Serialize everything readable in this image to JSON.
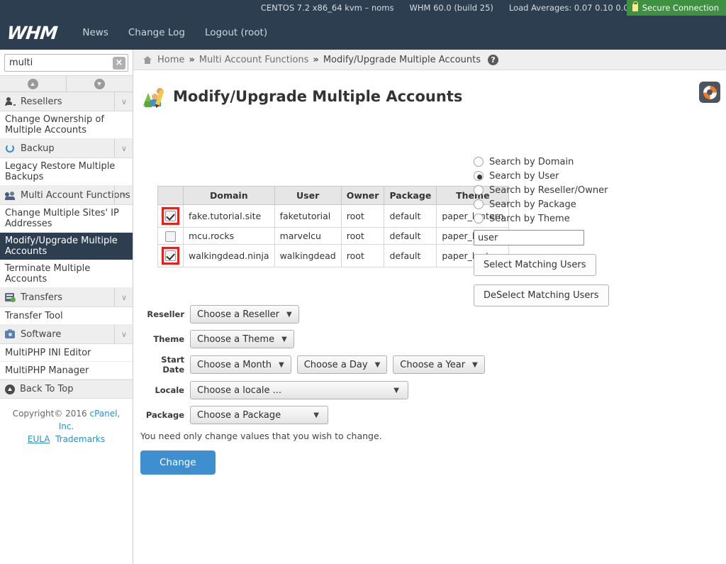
{
  "topbar": {
    "os": "CENTOS 7.2 x86_64 kvm – noms",
    "version": "WHM 60.0 (build 25)",
    "load": "Load Averages: 0.07 0.10 0.07",
    "secure_label": "Secure Connection",
    "lock_icon": "lock-icon",
    "secure_color": "#3d9140"
  },
  "nav": {
    "logo": "WHM",
    "links": [
      {
        "label": "News"
      },
      {
        "label": "Change Log"
      },
      {
        "label": "Logout (root)"
      }
    ]
  },
  "sidebar": {
    "search_value": "multi",
    "search_placeholder": "Search",
    "clear_icon": "close-icon",
    "scroll_up_icon": "chevron-up-icon",
    "scroll_down_icon": "chevron-down-icon",
    "items": [
      {
        "type": "category",
        "label": "Resellers",
        "icon": "resellers-icon",
        "chevron": "∨"
      },
      {
        "type": "leaf",
        "label": "Change Ownership of Multiple Accounts",
        "active": false
      },
      {
        "type": "category",
        "label": "Backup",
        "icon": "backup-icon",
        "chevron": "∨"
      },
      {
        "type": "leaf",
        "label": "Legacy Restore Multiple Backups",
        "active": false
      },
      {
        "type": "category",
        "label": "Multi Account Functions",
        "icon": "multi-account-icon",
        "chevron": "∨"
      },
      {
        "type": "leaf",
        "label": "Change Multiple Sites' IP Addresses",
        "active": false
      },
      {
        "type": "leaf",
        "label": "Modify/Upgrade Multiple Accounts",
        "active": true
      },
      {
        "type": "leaf",
        "label": "Terminate Multiple Accounts",
        "active": false
      },
      {
        "type": "category",
        "label": "Transfers",
        "icon": "transfers-icon",
        "chevron": "∨"
      },
      {
        "type": "leaf",
        "label": "Transfer Tool",
        "active": false
      },
      {
        "type": "category",
        "label": "Software",
        "icon": "software-icon",
        "chevron": "∨"
      },
      {
        "type": "leaf",
        "label": "MultiPHP INI Editor",
        "active": false
      },
      {
        "type": "leaf",
        "label": "MultiPHP Manager",
        "active": false
      }
    ],
    "back_to_top": "Back To Top",
    "back_to_top_icon": "arrow-up-circle-icon",
    "copyright_prefix": "Copyright© 2016 ",
    "copyright_company": "cPanel, Inc.",
    "eula": "EULA",
    "trademarks": "Trademarks",
    "link_color": "#2a8fd4"
  },
  "breadcrumb": {
    "home_icon": "home-icon",
    "home": "Home",
    "sep": "»",
    "section": "Multi Account Functions",
    "current": "Modify/Upgrade Multiple Accounts",
    "help_icon": "help-circle-icon",
    "help_glyph": "?"
  },
  "page": {
    "title": "Modify/Upgrade Multiple Accounts",
    "title_icon": "modify-accounts-icon",
    "life_ring_icon": "life-ring-icon"
  },
  "accounts_table": {
    "columns": [
      "",
      "Domain",
      "User",
      "Owner",
      "Package",
      "Theme"
    ],
    "rows": [
      {
        "checked": true,
        "highlighted": true,
        "domain": "fake.tutorial.site",
        "user": "faketutorial",
        "owner": "root",
        "package": "default",
        "theme": "paper_lantern"
      },
      {
        "checked": false,
        "highlighted": false,
        "domain": "mcu.rocks",
        "user": "marvelcu",
        "owner": "root",
        "package": "default",
        "theme": "paper_lantern"
      },
      {
        "checked": true,
        "highlighted": true,
        "domain": "walkingdead.ninja",
        "user": "walkingdead",
        "owner": "root",
        "package": "default",
        "theme": "paper_lantern"
      }
    ],
    "highlight_color": "#e8201b"
  },
  "search_panel": {
    "options": [
      {
        "label": "Search by Domain",
        "selected": false
      },
      {
        "label": "Search by User",
        "selected": true
      },
      {
        "label": "Search by Reseller/Owner",
        "selected": false
      },
      {
        "label": "Search by Package",
        "selected": false
      },
      {
        "label": "Search by Theme",
        "selected": false
      }
    ],
    "match_value": "user",
    "match_placeholder": "",
    "select_button": "Select Matching Users",
    "deselect_button": "DeSelect Matching Users"
  },
  "form": {
    "reseller_label": "Reseller",
    "reseller_value": "Choose a Reseller",
    "theme_label": "Theme",
    "theme_value": "Choose a Theme",
    "start_date_label": "Start Date",
    "month_value": "Choose a Month",
    "day_value": "Choose a Day",
    "year_value": "Choose a Year",
    "locale_label": "Locale",
    "locale_value": "Choose a locale ...",
    "package_label": "Package",
    "package_value": "Choose a Package",
    "caret_icon": "chevron-down-icon",
    "hint": "You need only change values that you wish to change.",
    "submit_label": "Change",
    "submit_color": "#3f8fd0"
  }
}
